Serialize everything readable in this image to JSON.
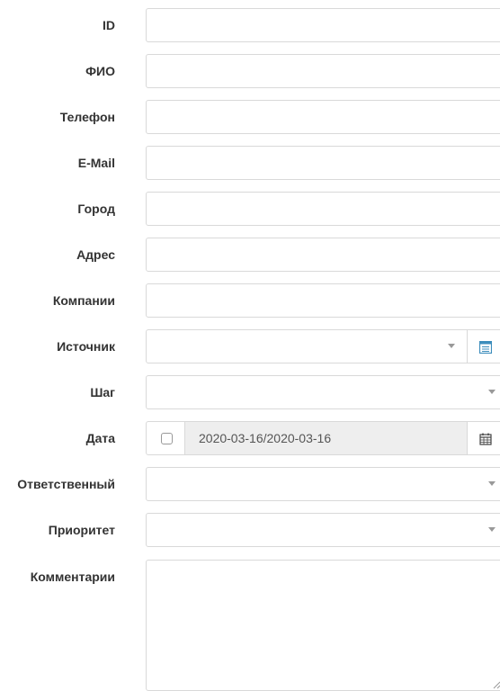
{
  "form": {
    "fields": [
      {
        "label": "ID"
      },
      {
        "label": "ФИО"
      },
      {
        "label": "Телефон"
      },
      {
        "label": "E-Mail"
      },
      {
        "label": "Город"
      },
      {
        "label": "Адрес"
      },
      {
        "label": "Компании"
      },
      {
        "label": "Источник"
      },
      {
        "label": "Шаг"
      },
      {
        "label": "Дата",
        "value": "2020-03-16/2020-03-16"
      },
      {
        "label": "Ответственный"
      },
      {
        "label": "Приоритет"
      },
      {
        "label": "Комментарии"
      }
    ]
  },
  "icons": {
    "list": "list-icon",
    "calendar": "calendar-icon",
    "dropdown": "chevron-down-icon",
    "resize": "resize-handle-icon"
  },
  "colors": {
    "border": "#d9d9d9",
    "disabled_bg": "#eeeeee",
    "accent": "#3c8dbc"
  }
}
